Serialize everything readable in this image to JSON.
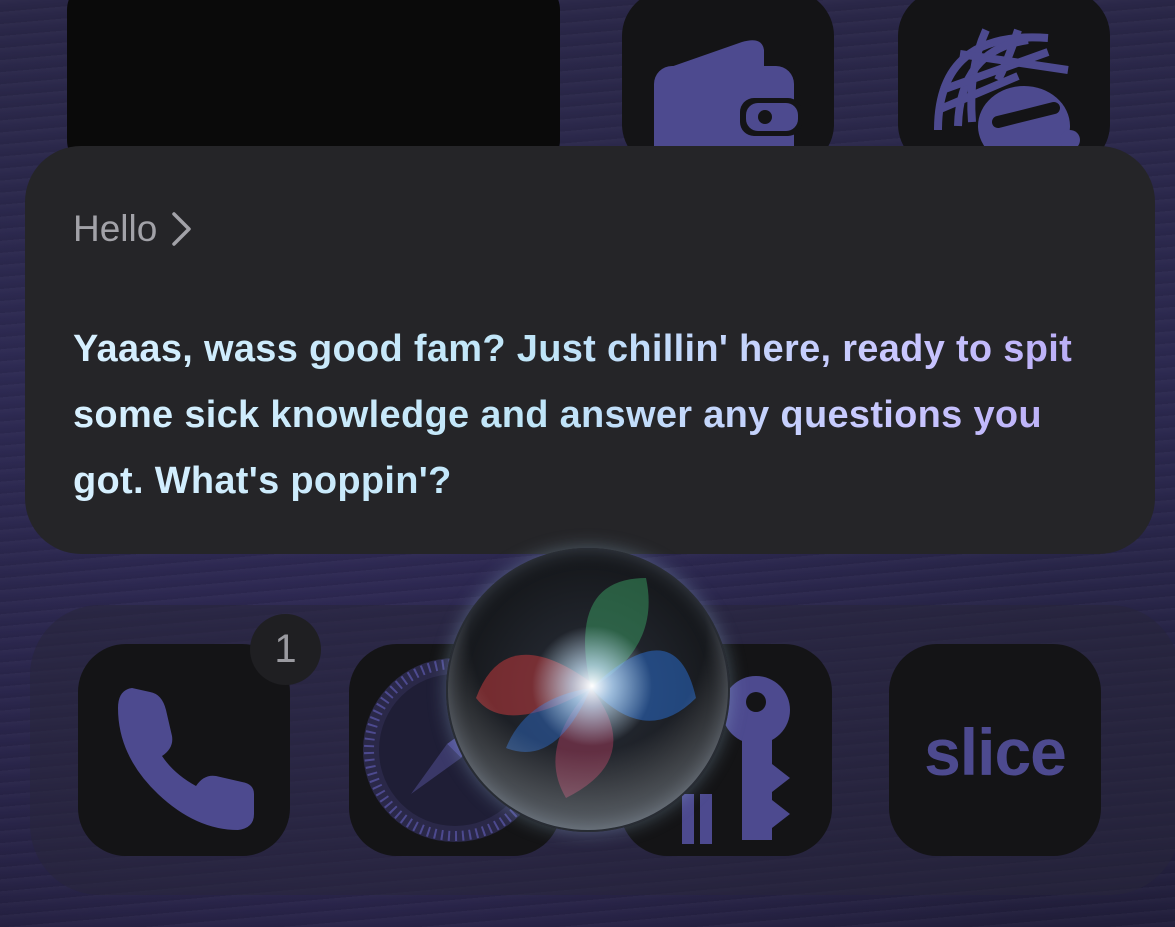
{
  "colors": {
    "card_bg": "#252528",
    "icon_purple": "#4d4a8f",
    "answer_gradient": [
      "#d7f0ff",
      "#c9c6ff",
      "#b7a8f5"
    ]
  },
  "home_screen": {
    "top_row_icons": [
      "wallet-icon",
      "globe-icon"
    ],
    "dock_apps": [
      {
        "name": "phone-app",
        "icon": "phone-icon",
        "badge": "1"
      },
      {
        "name": "safari-app",
        "icon": "compass-icon"
      },
      {
        "name": "passwords-app",
        "icon": "key-icon"
      },
      {
        "name": "slice-app",
        "label": "slice"
      }
    ]
  },
  "siri": {
    "prompt": "Hello",
    "chevron_icon": "chevron-right-icon",
    "response": "Yaaas, wass good fam? Just chillin' here, ready to spit some sick knowledge and answer any questions you got. What's poppin'?",
    "orb_icon": "siri-orb-icon"
  }
}
